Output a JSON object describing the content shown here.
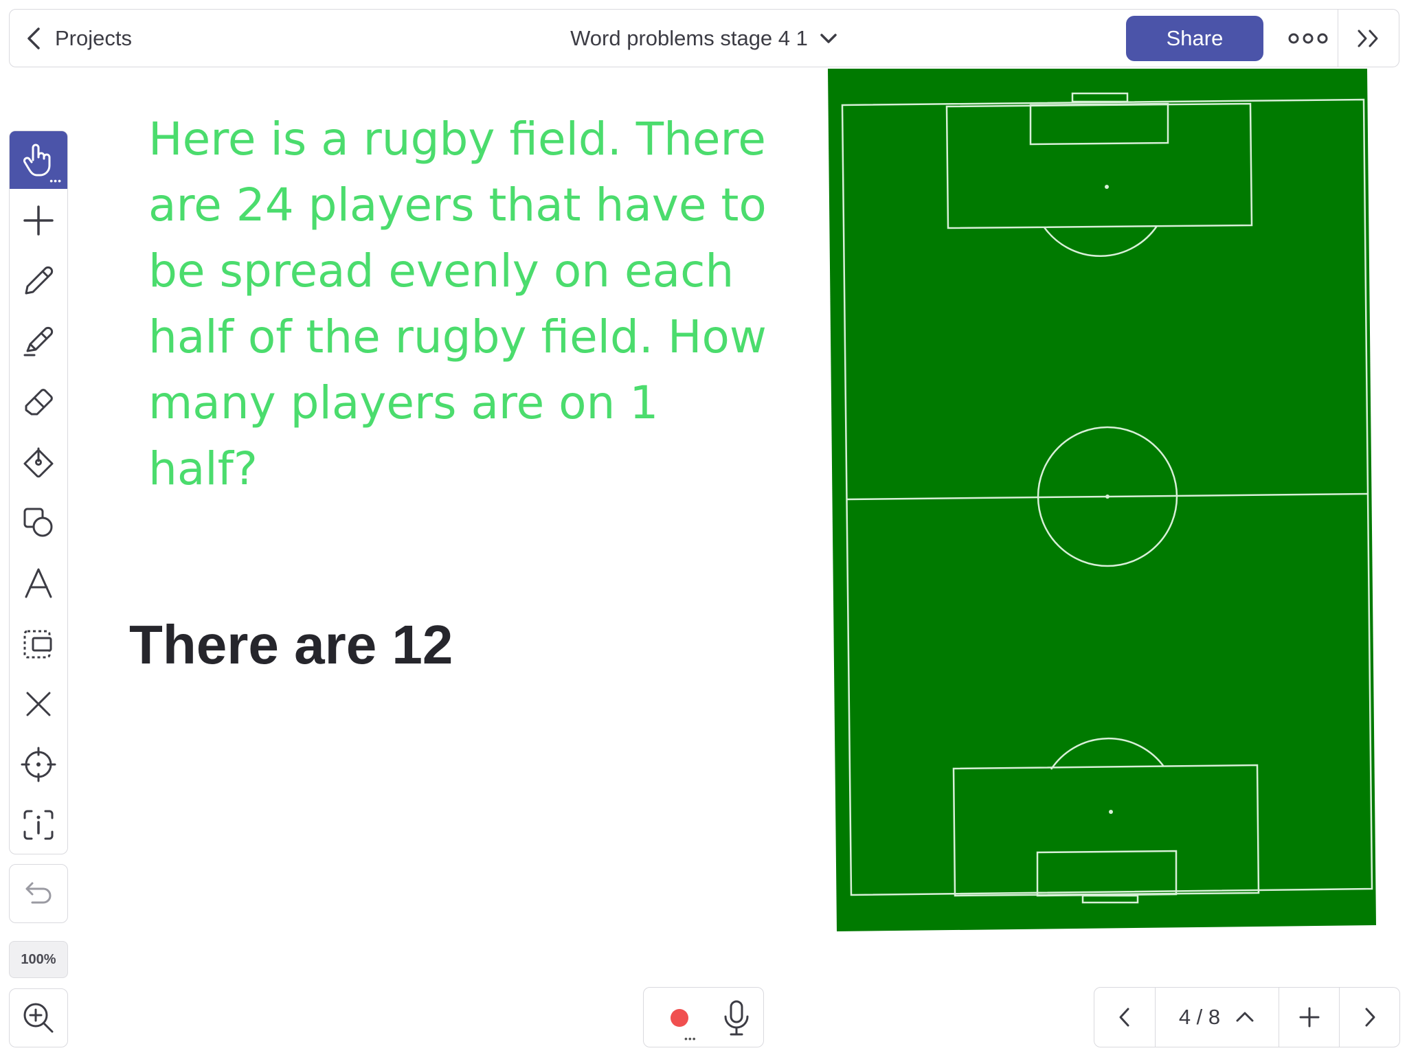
{
  "header": {
    "back_label": "Projects",
    "title": "Word problems stage 4 1",
    "share_label": "Share"
  },
  "toolbar": {
    "active_tool": "select-hand",
    "tools": [
      "select-hand",
      "add",
      "pencil",
      "marker",
      "eraser",
      "fill",
      "shapes",
      "text",
      "frame-select",
      "delete",
      "laser-pointer",
      "info-frame"
    ],
    "zoom_label": "100%"
  },
  "canvas": {
    "question": "Here is a rugby field. There are 24 players that have to be spread evenly on each half of the rugby field. How many players are on 1 half?",
    "answer": "There are 12",
    "colors": {
      "question_text": "#4bdc6d",
      "answer_text": "#26262c",
      "field_green": "#007a00",
      "field_lines": "#d8f0d8"
    }
  },
  "footer": {
    "page_indicator": "4 / 8"
  },
  "colors": {
    "accent": "#4b54a9",
    "record": "#f04f4f"
  }
}
